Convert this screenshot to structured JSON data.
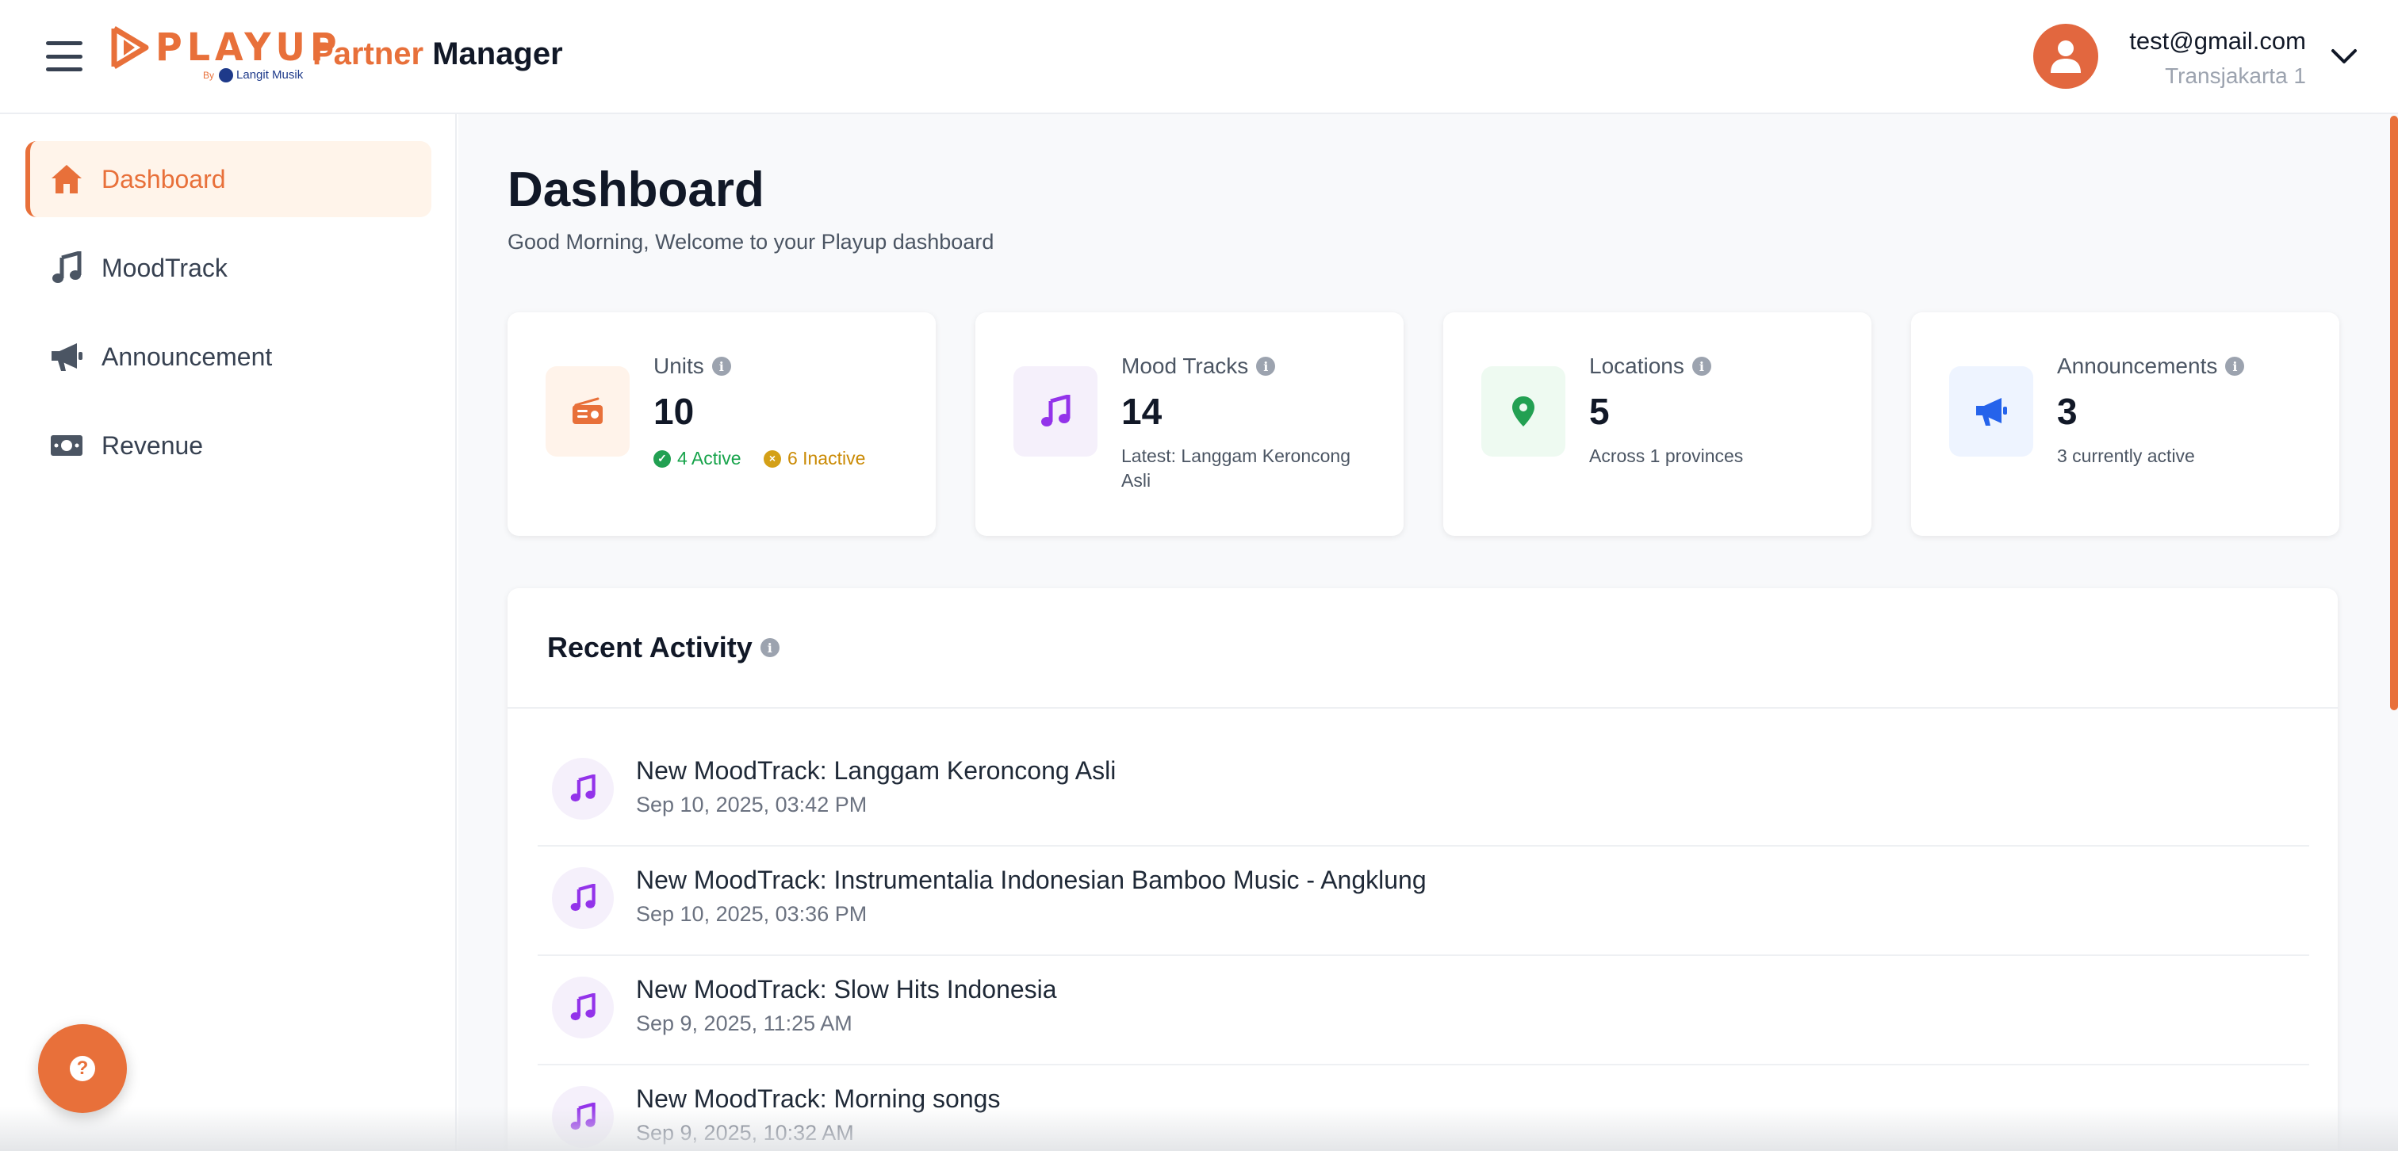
{
  "header": {
    "logo_text": "PLAYUP",
    "logo_by": "By",
    "logo_partner": "Langit Musik",
    "title_accent": "Partner",
    "title_main": "Manager",
    "user_email": "test@gmail.com",
    "user_org": "Transjakarta 1",
    "icons": {
      "menu": "hamburger-icon",
      "avatar": "user-icon",
      "dropdown": "chevron-down-icon"
    }
  },
  "sidebar": {
    "items": [
      {
        "label": "Dashboard",
        "icon": "home-icon",
        "active": true
      },
      {
        "label": "MoodTrack",
        "icon": "music-note-icon",
        "active": false
      },
      {
        "label": "Announcement",
        "icon": "megaphone-icon",
        "active": false
      },
      {
        "label": "Revenue",
        "icon": "money-icon",
        "active": false
      }
    ],
    "help_icon": "question-icon"
  },
  "main": {
    "title": "Dashboard",
    "subtitle": "Good Morning, Welcome to your Playup dashboard",
    "stats": [
      {
        "label": "Units",
        "value": "10",
        "active_text": "4 Active",
        "inactive_text": "6 Inactive",
        "icon": "radio-icon",
        "color": "#e8703a",
        "bg": "#fff3ea"
      },
      {
        "label": "Mood Tracks",
        "value": "14",
        "sub": "Latest: Langgam Keroncong Asli",
        "icon": "music-note-icon",
        "color": "#9333ea",
        "bg": "#f5f0fb"
      },
      {
        "label": "Locations",
        "value": "5",
        "sub": "Across 1 provinces",
        "icon": "map-pin-icon",
        "color": "#22a052",
        "bg": "#eefaf1"
      },
      {
        "label": "Announcements",
        "value": "3",
        "sub": "3 currently active",
        "icon": "megaphone-icon",
        "color": "#2563eb",
        "bg": "#eef4ff"
      }
    ],
    "activity": {
      "title": "Recent Activity",
      "items": [
        {
          "title": "New MoodTrack: Langgam Keroncong Asli",
          "time": "Sep 10, 2025, 03:42 PM"
        },
        {
          "title": "New MoodTrack: Instrumentalia Indonesian Bamboo Music - Angklung",
          "time": "Sep 10, 2025, 03:36 PM"
        },
        {
          "title": "New MoodTrack: Slow Hits Indonesia",
          "time": "Sep 9, 2025, 11:25 AM"
        },
        {
          "title": "New MoodTrack: Morning songs",
          "time": "Sep 9, 2025, 10:32 AM"
        }
      ]
    }
  },
  "colors": {
    "accent": "#e8703a",
    "music": "#9333ea",
    "location": "#22a052",
    "announcement": "#2563eb"
  }
}
